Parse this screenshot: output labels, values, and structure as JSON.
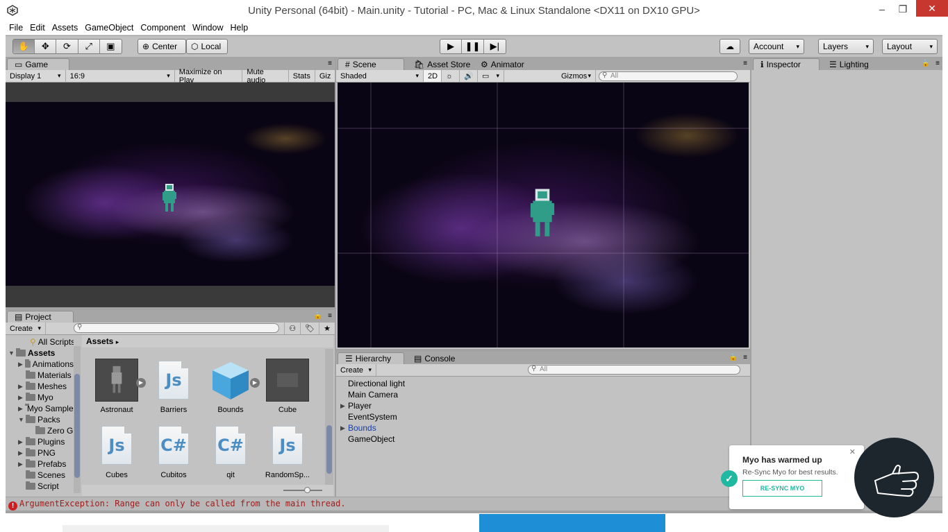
{
  "window": {
    "title": "Unity Personal (64bit) - Main.unity - Tutorial - PC, Mac & Linux Standalone <DX11 on DX10 GPU>",
    "minimize": "–",
    "maximize": "❐",
    "close": "✕"
  },
  "menu": [
    "File",
    "Edit",
    "Assets",
    "GameObject",
    "Component",
    "Window",
    "Help"
  ],
  "toolbar": {
    "pivot": "Center",
    "space": "Local",
    "account": "Account",
    "layers": "Layers",
    "layout": "Layout",
    "cloud_icon": "cloud-icon"
  },
  "game_panel": {
    "tab": "Game",
    "display": "Display 1",
    "aspect": "16:9",
    "maximize": "Maximize on Play",
    "mute": "Mute audio",
    "stats": "Stats",
    "gizmos": "Giz"
  },
  "scene_panel": {
    "tabs": [
      "Scene",
      "Asset Store",
      "Animator"
    ],
    "shading": "Shaded",
    "mode_2d": "2D",
    "gizmos": "Gizmos",
    "search_placeholder": "All"
  },
  "inspector_panel": {
    "tabs": [
      "Inspector",
      "Lighting"
    ]
  },
  "project_panel": {
    "tab": "Project",
    "create": "Create",
    "breadcrumb": "Assets",
    "tree": [
      {
        "label": "All Scripts",
        "indent": 2,
        "type": "search"
      },
      {
        "label": "Assets",
        "indent": 0,
        "type": "folder",
        "expanded": true,
        "bold": true
      },
      {
        "label": "Animations",
        "indent": 1,
        "type": "folder",
        "arrow": true
      },
      {
        "label": "Materials",
        "indent": 1,
        "type": "folder"
      },
      {
        "label": "Meshes",
        "indent": 1,
        "type": "folder",
        "arrow": true
      },
      {
        "label": "Myo",
        "indent": 1,
        "type": "folder",
        "arrow": true
      },
      {
        "label": "Myo Samples",
        "indent": 1,
        "type": "folder",
        "arrow": true
      },
      {
        "label": "Packs",
        "indent": 1,
        "type": "folder",
        "expanded": true
      },
      {
        "label": "Zero G",
        "indent": 2,
        "type": "folder"
      },
      {
        "label": "Plugins",
        "indent": 1,
        "type": "folder",
        "arrow": true
      },
      {
        "label": "PNG",
        "indent": 1,
        "type": "folder",
        "arrow": true
      },
      {
        "label": "Prefabs",
        "indent": 1,
        "type": "folder",
        "arrow": true
      },
      {
        "label": "Scenes",
        "indent": 1,
        "type": "folder"
      },
      {
        "label": "Script",
        "indent": 1,
        "type": "folder"
      }
    ],
    "assets": [
      {
        "label": "Astronaut",
        "kind": "model"
      },
      {
        "label": "Barriers",
        "kind": "js"
      },
      {
        "label": "Bounds",
        "kind": "cube"
      },
      {
        "label": "Cube",
        "kind": "material"
      },
      {
        "label": "Cubes",
        "kind": "js"
      },
      {
        "label": "Cubitos",
        "kind": "cs"
      },
      {
        "label": "qit",
        "kind": "cs"
      },
      {
        "label": "RandomSp...",
        "kind": "js"
      }
    ]
  },
  "hierarchy_panel": {
    "tabs": [
      "Hierarchy",
      "Console"
    ],
    "create": "Create",
    "search_placeholder": "All",
    "items": [
      {
        "label": "Directional light",
        "arrow": false,
        "highlight": false
      },
      {
        "label": "Main Camera",
        "arrow": false,
        "highlight": false
      },
      {
        "label": "Player",
        "arrow": true,
        "highlight": false
      },
      {
        "label": "EventSystem",
        "arrow": false,
        "highlight": false
      },
      {
        "label": "Bounds",
        "arrow": true,
        "highlight": true
      },
      {
        "label": "GameObject",
        "arrow": false,
        "highlight": false
      }
    ]
  },
  "status": {
    "error": "ArgumentException: Range can only be called from the main thread."
  },
  "myo": {
    "title": "Myo has warmed up",
    "body": "Re-Sync Myo for best results.",
    "button": "RE-SYNC MYO",
    "accent": "#1fb8a0"
  },
  "colors": {
    "panel_bg": "#c2c2c2",
    "link_blue": "#1a3c9e",
    "error_red": "#cc1f1f"
  }
}
